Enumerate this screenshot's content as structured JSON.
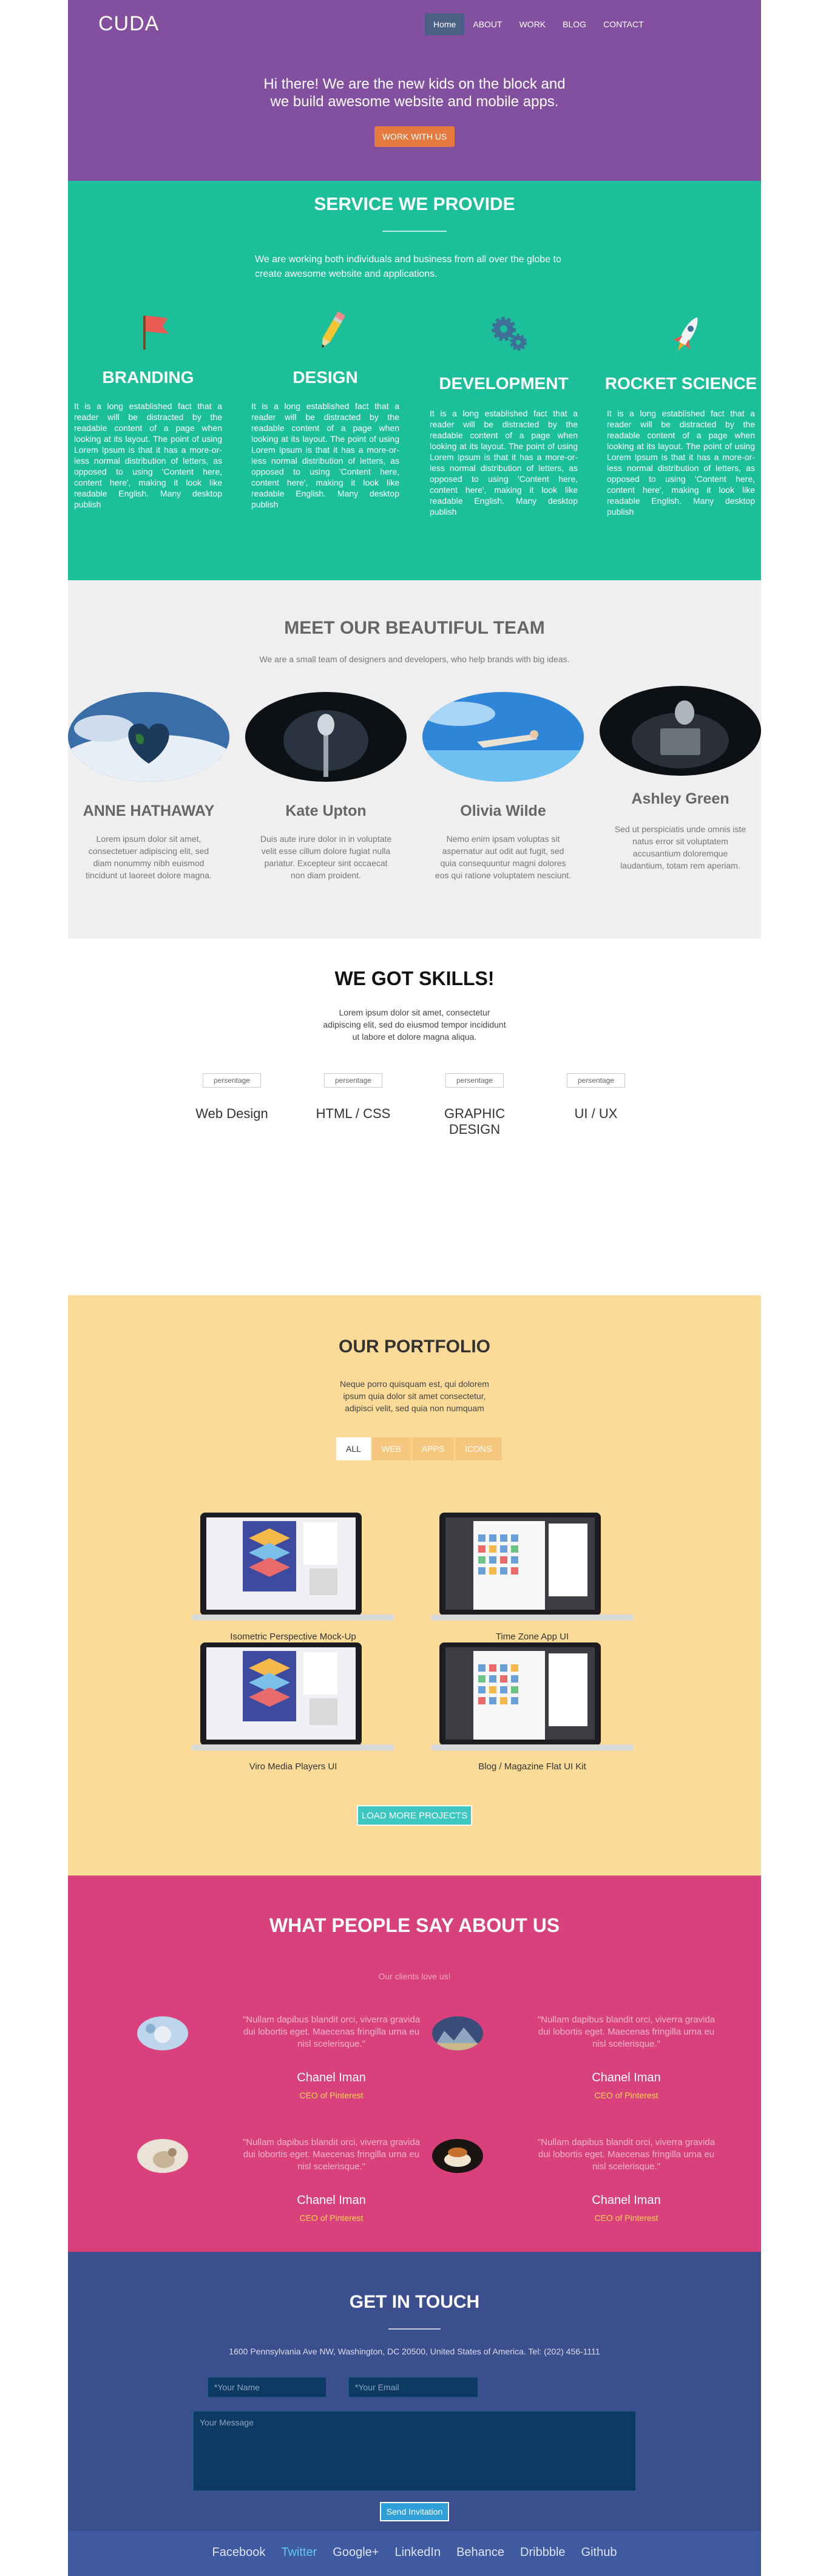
{
  "header": {
    "logo": "CUDA",
    "nav": [
      "Home",
      "ABOUT",
      "WORK",
      "BLOG",
      "CONTACT"
    ],
    "hero_line1": "Hi there! We are the new kids on the block and",
    "hero_line2": "we build awesome website and mobile apps.",
    "cta": "WORK WITH US"
  },
  "services": {
    "title": "SERVICE WE PROVIDE",
    "subtitle": "We are working both individuals and business from all over the globe to create awesome website and applications.",
    "items": [
      {
        "title": "BRANDING",
        "icon": "flag-icon",
        "text": "It is a long established fact that a reader will be distracted by the readable content of a page when looking at its layout. The point of using Lorem Ipsum is that it has a more-or-less normal distribution of letters, as opposed to using 'Content here, content here', making it look like readable English. Many desktop publish"
      },
      {
        "title": "DESIGN",
        "icon": "pencil-icon",
        "text": "It is a long established fact that a reader will be distracted by the readable content of a page when looking at its layout. The point of using Lorem Ipsum is that it has a more-or-less normal distribution of letters, as opposed to using 'Content here, content here', making it look like readable English. Many desktop publish"
      },
      {
        "title": "DEVELOPMENT",
        "icon": "gears-icon",
        "text": "It is a long established fact that a reader will be distracted by the readable content of a page when looking at its layout. The point of using Lorem Ipsum is that it has a more-or-less normal distribution of letters, as opposed to using 'Content here, content here', making it look like readable English. Many desktop publish"
      },
      {
        "title": "ROCKET SCIENCE",
        "icon": "rocket-icon",
        "text": "It is a long established fact that a reader will be distracted by the readable content of a page when looking at its layout. The point of using Lorem Ipsum is that it has a more-or-less normal distribution of letters, as opposed to using 'Content here, content here', making it look like readable English. Many desktop publish"
      }
    ]
  },
  "team": {
    "title": "MEET OUR BEAUTIFUL TEAM",
    "subtitle": "We are a small team of designers and developers, who help brands with big ideas.",
    "members": [
      {
        "name": "ANNE HATHAWAY",
        "bio": "Lorem ipsum dolor sit amet, consectetuer adipiscing elit, sed diam nonummy nibh euismod tincidunt ut laoreet dolore magna."
      },
      {
        "name": "Kate Upton",
        "bio": "Duis aute irure dolor in in voluptate velit esse cillum dolore fugiat nulla pariatur. Excepteur sint occaecat non diam proident."
      },
      {
        "name": "Olivia Wilde",
        "bio": "Nemo enim ipsam voluptas sit aspernatur aut odit aut fugit, sed quia consequuntur magni dolores eos qui ratione voluptatem nesciunt."
      },
      {
        "name": "Ashley Green",
        "bio": "Sed ut perspiciatis unde omnis iste natus error sit voluptatem accusantium doloremque laudantium, totam rem aperiam."
      }
    ]
  },
  "skills": {
    "title": "WE GOT SKILLS!",
    "subtitle": "Lorem ipsum dolor sit amet, consectetur adipiscing elit, sed do eiusmod tempor incididunt ut labore et dolore magna aliqua.",
    "items": [
      {
        "alt": "persentage",
        "label": "Web Design"
      },
      {
        "alt": "persentage",
        "label": "HTML / CSS"
      },
      {
        "alt": "persentage",
        "label": "GRAPHIC DESIGN"
      },
      {
        "alt": "persentage",
        "label": "UI / UX"
      }
    ]
  },
  "portfolio": {
    "title": "OUR PORTFOLIO",
    "subtitle": "Neque porro quisquam est, qui dolorem ipsum quia dolor sit amet consectetur, adipisci velit, sed quia non numquam",
    "filters": [
      "ALL",
      "WEB",
      "APPS",
      "ICONS"
    ],
    "works": [
      "Isometric Perspective Mock-Up",
      "Time Zone App UI",
      "Viro Media Players UI",
      "Blog / Magazine Flat UI Kit"
    ],
    "load_more": "LOAD MORE PROJECTS"
  },
  "testimonials": {
    "title": "WHAT PEOPLE SAY ABOUT US",
    "subtitle": "Our clients love us!",
    "items": [
      {
        "quote": "\"Nullam dapibus blandit orci, viverra gravida dui lobortis eget. Maecenas fringilla urna eu nisl scelerisque.\"",
        "name": "Chanel Iman",
        "role": "CEO of Pinterest"
      },
      {
        "quote": "\"Nullam dapibus blandit orci, viverra gravida dui lobortis eget. Maecenas fringilla urna eu nisl scelerisque.\"",
        "name": "Chanel Iman",
        "role": "CEO of Pinterest"
      },
      {
        "quote": "\"Nullam dapibus blandit orci, viverra gravida dui lobortis eget. Maecenas fringilla urna eu nisl scelerisque.\"",
        "name": "Chanel Iman",
        "role": "CEO of Pinterest"
      },
      {
        "quote": "\"Nullam dapibus blandit orci, viverra gravida dui lobortis eget. Maecenas fringilla urna eu nisl scelerisque.\"",
        "name": "Chanel Iman",
        "role": "CEO of Pinterest"
      }
    ]
  },
  "contact": {
    "title": "GET IN TOUCH",
    "address": "1600 Pennsylvania Ave NW, Washington, DC 20500, United States of America. Tel: (202) 456-1111",
    "name_placeholder": "*Your Name",
    "email_placeholder": "*Your Email",
    "message_placeholder": "Your Message",
    "send": "Send Invitation"
  },
  "footer": {
    "links": [
      "Facebook",
      "Twitter",
      "Google+",
      "LinkedIn",
      "Behance",
      "Dribbble",
      "Github"
    ]
  },
  "colors": {
    "header": "#8350a0",
    "services": "#1bbf99",
    "team": "#efefef",
    "portfolio": "#fcdb98",
    "testimonials": "#d9417c",
    "contact": "#3b4f8f",
    "footer": "#3f5aa0",
    "cta": "#e77a3e"
  }
}
